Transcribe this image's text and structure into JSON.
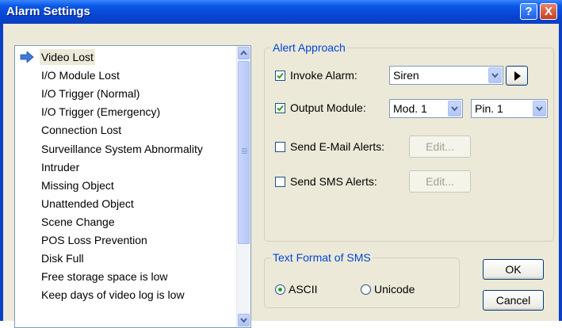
{
  "window": {
    "title": "Alarm Settings",
    "help_glyph": "?",
    "close_glyph": "X"
  },
  "event_list": {
    "selected_index": 0,
    "items": [
      "Video Lost",
      "I/O Module Lost",
      "I/O Trigger (Normal)",
      "I/O Trigger (Emergency)",
      "Connection Lost",
      "Surveillance System Abnormality",
      "Intruder",
      "Missing Object",
      "Unattended Object",
      "Scene Change",
      "POS Loss Prevention",
      "Disk Full",
      "Free storage space is low",
      "Keep days of video log is low"
    ]
  },
  "alert_approach": {
    "legend": "Alert Approach",
    "invoke_alarm": {
      "label": "Invoke Alarm:",
      "checked": true,
      "value": "Siren"
    },
    "output_module": {
      "label": "Output Module:",
      "checked": true,
      "module": "Mod. 1",
      "pin": "Pin. 1"
    },
    "email": {
      "label": "Send E-Mail Alerts:",
      "checked": false,
      "edit_label": "Edit..."
    },
    "sms": {
      "label": "Send SMS Alerts:",
      "checked": false,
      "edit_label": "Edit..."
    }
  },
  "sms_format": {
    "legend": "Text Format of SMS",
    "ascii_label": "ASCII",
    "unicode_label": "Unicode",
    "selected": "ASCII"
  },
  "buttons": {
    "ok": "OK",
    "cancel": "Cancel"
  },
  "colors": {
    "title_bar": "#0a57e6",
    "accent": "#0046d5",
    "check": "#2c9d2c"
  }
}
